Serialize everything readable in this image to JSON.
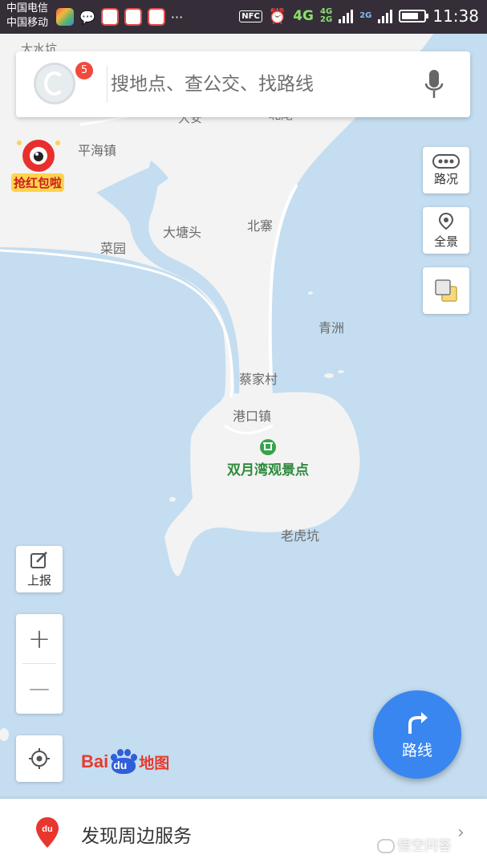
{
  "status_bar": {
    "carrier_1": "中国电信",
    "carrier_2": "中国移动",
    "nfc": "NFC",
    "network": "4G",
    "network_small_1": "4G",
    "network_small_2": "2G",
    "network_small_3": "2G",
    "time": "11:38",
    "battery_level": 0.75
  },
  "search": {
    "placeholder": "搜地点、查公交、找路线",
    "notification_count": "5"
  },
  "mascot": {
    "label": "抢红包啦"
  },
  "map": {
    "labels": {
      "top_partial": "大水坑",
      "partial_2": "大安",
      "partial_3": "北尾",
      "pinghai": "平海镇",
      "datangtou": "大塘头",
      "beizhai": "北寨",
      "caiyuan": "菜园",
      "qingzhou": "青洲",
      "caijiacun": "蔡家村",
      "gangkouzhen": "港口镇",
      "laohukeng": "老虎坑"
    },
    "poi_name": "双月湾观景点"
  },
  "right_controls": {
    "traffic": "路况",
    "panorama": "全景"
  },
  "left_controls": {
    "report": "上报",
    "zoom_in": "+",
    "zoom_out": "—"
  },
  "logo": {
    "bai": "Bai",
    "du": "du",
    "map": "地图"
  },
  "route_button": {
    "label": "路线"
  },
  "bottom_sheet": {
    "label": "发现周边服务",
    "chevron": "›",
    "watermark": "悟空问答"
  },
  "colors": {
    "water": "#c4ddf0",
    "land": "#f3f3f3",
    "accent": "#3a86f0",
    "poi": "#37a34a",
    "badge": "#f04a3c"
  }
}
